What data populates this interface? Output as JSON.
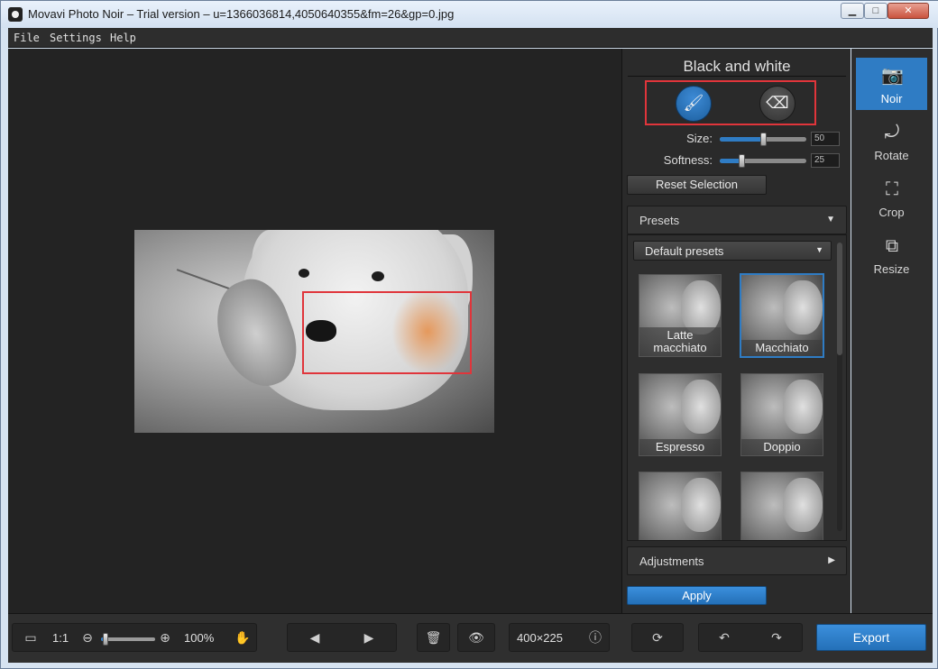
{
  "window": {
    "title": "Movavi Photo Noir – Trial version – u=1366036814,4050640355&fm=26&gp=0.jpg",
    "controls": {
      "minimize": "▁",
      "maximize": "□",
      "close": "✕"
    }
  },
  "menu": {
    "file": "File",
    "settings": "Settings",
    "help": "Help"
  },
  "panel": {
    "title": "Black and white",
    "brush_icon": "brush-icon",
    "eraser_icon": "eraser-icon",
    "size": {
      "label": "Size:",
      "value": "50",
      "fraction": 0.5
    },
    "softness": {
      "label": "Softness:",
      "value": "25",
      "fraction": 0.25
    },
    "reset_selection": "Reset Selection",
    "presets": {
      "header": "Presets",
      "dropdown": "Default presets",
      "items": [
        {
          "label": "Latte macchiato",
          "selected": false
        },
        {
          "label": "Macchiato",
          "selected": true
        },
        {
          "label": "Espresso",
          "selected": false
        },
        {
          "label": "Doppio",
          "selected": false
        },
        {
          "label": "",
          "selected": false
        },
        {
          "label": "",
          "selected": false
        }
      ]
    },
    "adjustments": "Adjustments",
    "apply": "Apply"
  },
  "right_toolbar": [
    {
      "label": "Noir",
      "icon": "camera-icon",
      "active": true
    },
    {
      "label": "Rotate",
      "icon": "rotate-icon",
      "active": false
    },
    {
      "label": "Crop",
      "icon": "crop-icon",
      "active": false
    },
    {
      "label": "Resize",
      "icon": "resize-icon",
      "active": false
    }
  ],
  "bottom": {
    "ratio_label": "1:1",
    "zoom_fraction": 0.08,
    "zoom_value": "100%",
    "dimensions": "400×225",
    "export": "Export"
  },
  "colors": {
    "accent": "#2f7cc4",
    "highlight": "#e0353b",
    "background": "#232323"
  }
}
